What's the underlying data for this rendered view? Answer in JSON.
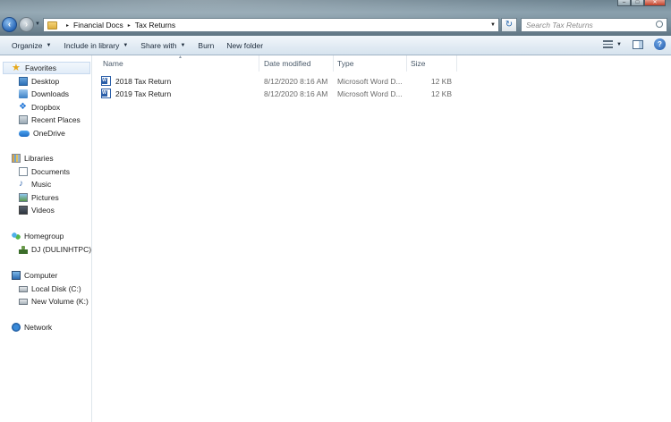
{
  "window": {
    "controls": [
      "–",
      "□",
      "✕"
    ]
  },
  "address_bar": {
    "crumbs": [
      "Financial Docs",
      "Tax Returns"
    ],
    "separator": "▸"
  },
  "search": {
    "placeholder": "Search Tax Returns"
  },
  "toolbar": {
    "organize": "Organize",
    "include_in_library": "Include in library",
    "share_with": "Share with",
    "burn": "Burn",
    "new_folder": "New folder",
    "help": "?"
  },
  "nav_pane": {
    "favorites": {
      "label": "Favorites",
      "items": [
        "Desktop",
        "Downloads",
        "Dropbox",
        "Recent Places",
        "OneDrive"
      ]
    },
    "libraries": {
      "label": "Libraries",
      "items": [
        "Documents",
        "Music",
        "Pictures",
        "Videos"
      ]
    },
    "homegroup": {
      "label": "Homegroup",
      "items": [
        "DJ (DULINHTPC)"
      ]
    },
    "computer": {
      "label": "Computer",
      "items": [
        "Local Disk (C:)",
        "New Volume (K:)"
      ]
    },
    "network": {
      "label": "Network"
    }
  },
  "columns": {
    "name": "Name",
    "date_modified": "Date modified",
    "type": "Type",
    "size": "Size"
  },
  "files": [
    {
      "name": "2018 Tax Return",
      "date": "8/12/2020 8:16 AM",
      "type": "Microsoft Word D...",
      "size": "12 KB",
      "icon": "word-document-icon"
    },
    {
      "name": "2019 Tax Return",
      "date": "8/12/2020 8:16 AM",
      "type": "Microsoft Word D...",
      "size": "12 KB",
      "icon": "word-document-icon"
    }
  ]
}
